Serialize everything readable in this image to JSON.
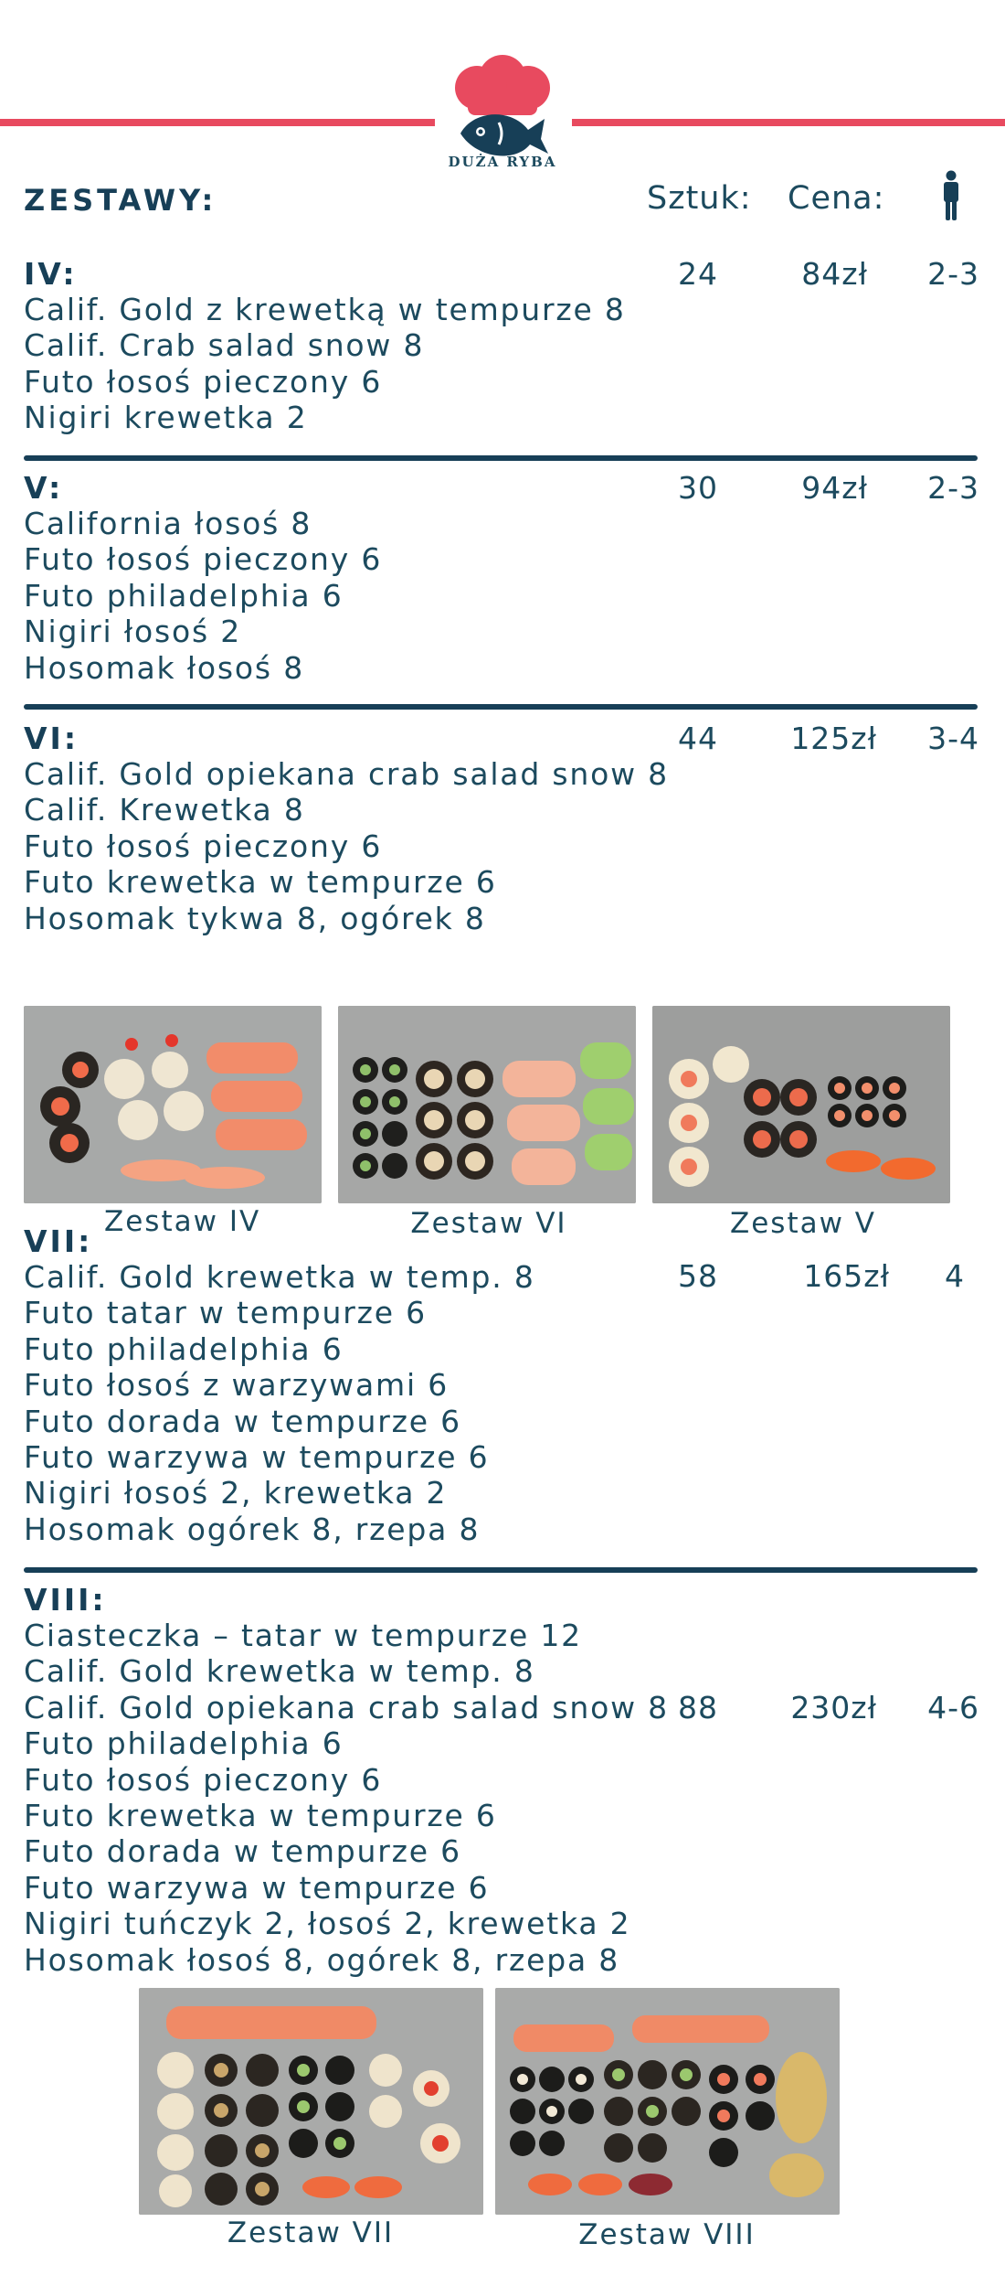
{
  "brand": {
    "name": "DUŻA RYBA",
    "accent_color": "#e84a5f",
    "primary_color": "#173f57",
    "icon": "chef-hat-fish-icon"
  },
  "header": {
    "title": "ZESTAWY:",
    "col_pieces": "Sztuk:",
    "col_price": "Cena:",
    "col_persons_icon": "person-icon"
  },
  "sets": [
    {
      "name": "IV:",
      "pieces": "24",
      "price": "84zł",
      "persons": "2-3",
      "items": [
        "Calif. Gold z krewetką w tempurze 8",
        "Calif. Crab salad snow 8",
        "Futo łosoś pieczony  6",
        "Nigiri krewetka 2"
      ]
    },
    {
      "name": "V:",
      "pieces": "30",
      "price": "94zł",
      "persons": "2-3",
      "items": [
        "California łosoś 8",
        "Futo łosoś pieczony 6",
        "Futo philadelphia 6",
        "Nigiri łosoś 2",
        "Hosomak łosoś 8"
      ]
    },
    {
      "name": "VI:",
      "pieces": "44",
      "price": "125zł",
      "persons": "3-4",
      "items": [
        "Calif. Gold opiekana crab salad snow 8",
        "Calif. Krewetka 8",
        "Futo łosoś pieczony 6",
        "Futo krewetka w tempurze 6",
        "Hosomak tykwa 8, ogórek 8"
      ]
    },
    {
      "name": "VII:",
      "pieces": "58",
      "price": "165zł",
      "persons": "4",
      "items": [
        "Calif. Gold krewetka w temp. 8",
        "Futo tatar w tempurze 6",
        "Futo philadelphia 6",
        "Futo łosoś z warzywami 6",
        "Futo dorada w tempurze 6",
        "Futo warzywa w tempurze 6",
        "Nigiri łosoś 2, krewetka 2",
        "Hosomak ogórek 8, rzepa 8"
      ]
    },
    {
      "name": "VIII:",
      "pieces": "88",
      "price": "230zł",
      "persons": "4-6",
      "items": [
        "Ciasteczka – tatar w tempurze 12",
        "Calif. Gold krewetka w temp. 8",
        "Calif. Gold opiekana crab salad snow 8",
        "Futo philadelphia 6",
        "Futo łosoś pieczony 6",
        "Futo krewetka w tempurze 6",
        "Futo dorada w tempurze 6",
        "Futo warzywa w tempurze 6",
        "Nigiri tuńczyk 2,  łosoś 2,  krewetka 2",
        "Hosomak łosoś 8, ogórek 8, rzepa 8"
      ]
    }
  ],
  "photos": [
    {
      "caption": "Zestaw IV"
    },
    {
      "caption": "Zestaw VI"
    },
    {
      "caption": "Zestaw V"
    },
    {
      "caption": "Zestaw VII"
    },
    {
      "caption": "Zestaw VIII"
    }
  ]
}
